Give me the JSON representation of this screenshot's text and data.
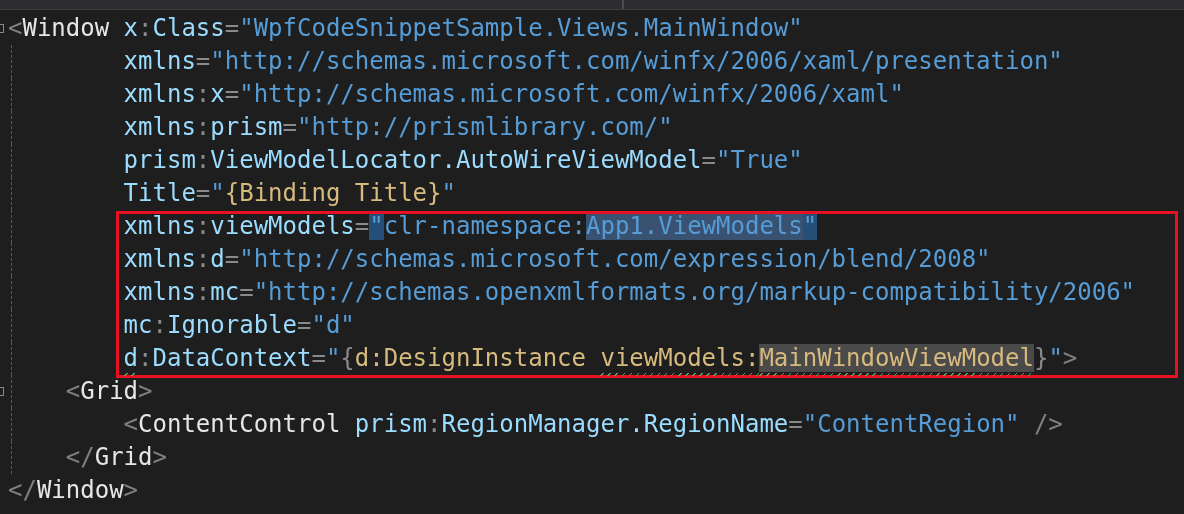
{
  "editor": {
    "document": {
      "fold": true,
      "open": [
        {
          "kind": "bracket",
          "text": "<"
        },
        {
          "kind": "element",
          "text": "Window "
        },
        {
          "kind": "attr",
          "text": "x"
        },
        {
          "kind": "punct",
          "text": ":"
        },
        {
          "kind": "attr",
          "text": "Class"
        },
        {
          "kind": "punct",
          "text": "="
        },
        {
          "kind": "string",
          "text": "\"WpfCodeSnippetSample.Views.MainWindow\""
        }
      ],
      "attribute_lines": [
        {
          "boxed": false,
          "tokens": [
            {
              "kind": "attr",
              "text": "xmlns"
            },
            {
              "kind": "punct",
              "text": "="
            },
            {
              "kind": "string",
              "text": "\"http://schemas.microsoft.com/winfx/2006/xaml/presentation\""
            }
          ]
        },
        {
          "boxed": false,
          "tokens": [
            {
              "kind": "attr",
              "text": "xmlns"
            },
            {
              "kind": "punct",
              "text": ":"
            },
            {
              "kind": "attr",
              "text": "x"
            },
            {
              "kind": "punct",
              "text": "="
            },
            {
              "kind": "string",
              "text": "\"http://schemas.microsoft.com/winfx/2006/xaml\""
            }
          ]
        },
        {
          "boxed": false,
          "tokens": [
            {
              "kind": "attr",
              "text": "xmlns"
            },
            {
              "kind": "punct",
              "text": ":"
            },
            {
              "kind": "attr",
              "text": "prism"
            },
            {
              "kind": "punct",
              "text": "="
            },
            {
              "kind": "string",
              "text": "\"http://prismlibrary.com/\""
            }
          ]
        },
        {
          "boxed": false,
          "tokens": [
            {
              "kind": "attr",
              "text": "prism"
            },
            {
              "kind": "punct",
              "text": ":"
            },
            {
              "kind": "attr",
              "text": "ViewModelLocator.AutoWireViewModel"
            },
            {
              "kind": "punct",
              "text": "="
            },
            {
              "kind": "string",
              "text": "\"True\""
            }
          ]
        },
        {
          "boxed": false,
          "tokens": [
            {
              "kind": "attr",
              "text": "Title"
            },
            {
              "kind": "punct",
              "text": "="
            },
            {
              "kind": "string",
              "text": "\""
            },
            {
              "kind": "markup",
              "text": "{Binding Title}"
            },
            {
              "kind": "string",
              "text": "\""
            }
          ]
        },
        {
          "boxed": true,
          "tokens": [
            {
              "kind": "attr",
              "text": "xmlns"
            },
            {
              "kind": "punct",
              "text": ":"
            },
            {
              "kind": "attr",
              "text": "viewModels"
            },
            {
              "kind": "punct",
              "text": "="
            },
            {
              "kind": "string",
              "text": "\"",
              "selected": true
            },
            {
              "kind": "string",
              "text": "clr-namespace:"
            },
            {
              "kind": "string",
              "text": "App1.ViewModels",
              "highlighted": true
            },
            {
              "kind": "string",
              "text": "\"",
              "selected": true
            }
          ]
        },
        {
          "boxed": true,
          "tokens": [
            {
              "kind": "attr",
              "text": "xmlns"
            },
            {
              "kind": "punct",
              "text": ":"
            },
            {
              "kind": "attr",
              "text": "d"
            },
            {
              "kind": "punct",
              "text": "="
            },
            {
              "kind": "string",
              "text": "\"http://schemas.microsoft.com/expression/blend/2008\""
            }
          ]
        },
        {
          "boxed": true,
          "tokens": [
            {
              "kind": "attr",
              "text": "xmlns"
            },
            {
              "kind": "punct",
              "text": ":"
            },
            {
              "kind": "attr",
              "text": "mc"
            },
            {
              "kind": "punct",
              "text": "="
            },
            {
              "kind": "string",
              "text": "\"http://schemas.openxmlformats.org/markup-compatibility/2006\""
            }
          ]
        },
        {
          "boxed": true,
          "tokens": [
            {
              "kind": "attr",
              "text": "mc"
            },
            {
              "kind": "punct",
              "text": ":"
            },
            {
              "kind": "attr",
              "text": "Ignorable"
            },
            {
              "kind": "punct",
              "text": "="
            },
            {
              "kind": "string",
              "text": "\"d\""
            }
          ]
        },
        {
          "boxed": true,
          "tokens": [
            {
              "kind": "attr",
              "text": "d",
              "squiggle": true
            },
            {
              "kind": "punct",
              "text": ":"
            },
            {
              "kind": "attr",
              "text": "DataContext"
            },
            {
              "kind": "punct",
              "text": "="
            },
            {
              "kind": "string",
              "text": "\""
            },
            {
              "kind": "punct",
              "text": "{"
            },
            {
              "kind": "markup",
              "text": "d:DesignInstance "
            },
            {
              "kind": "markup",
              "text": "viewModels:",
              "squiggle": true
            },
            {
              "kind": "markup",
              "text": "MainWindowViewModel",
              "squiggle": true,
              "highlighted": true
            },
            {
              "kind": "punct",
              "text": "}"
            },
            {
              "kind": "string",
              "text": "\""
            },
            {
              "kind": "bracket",
              "text": ">"
            }
          ]
        }
      ],
      "children": [
        {
          "fold": true,
          "open": [
            {
              "kind": "bracket",
              "text": "<"
            },
            {
              "kind": "element",
              "text": "Grid"
            },
            {
              "kind": "bracket",
              "text": ">"
            }
          ],
          "children": [
            {
              "fold": false,
              "open": [
                {
                  "kind": "bracket",
                  "text": "<"
                },
                {
                  "kind": "element",
                  "text": "ContentControl "
                },
                {
                  "kind": "attr",
                  "text": "prism"
                },
                {
                  "kind": "punct",
                  "text": ":"
                },
                {
                  "kind": "attr",
                  "text": "RegionManager.RegionName"
                },
                {
                  "kind": "punct",
                  "text": "="
                },
                {
                  "kind": "string",
                  "text": "\"ContentRegion\" "
                },
                {
                  "kind": "bracket",
                  "text": "/>"
                }
              ]
            }
          ],
          "close": [
            {
              "kind": "bracket",
              "text": "</"
            },
            {
              "kind": "element",
              "text": "Grid"
            },
            {
              "kind": "bracket",
              "text": ">"
            }
          ]
        }
      ],
      "close": [
        {
          "kind": "bracket",
          "text": "</"
        },
        {
          "kind": "element",
          "text": "Window"
        },
        {
          "kind": "bracket",
          "text": ">"
        }
      ]
    }
  }
}
